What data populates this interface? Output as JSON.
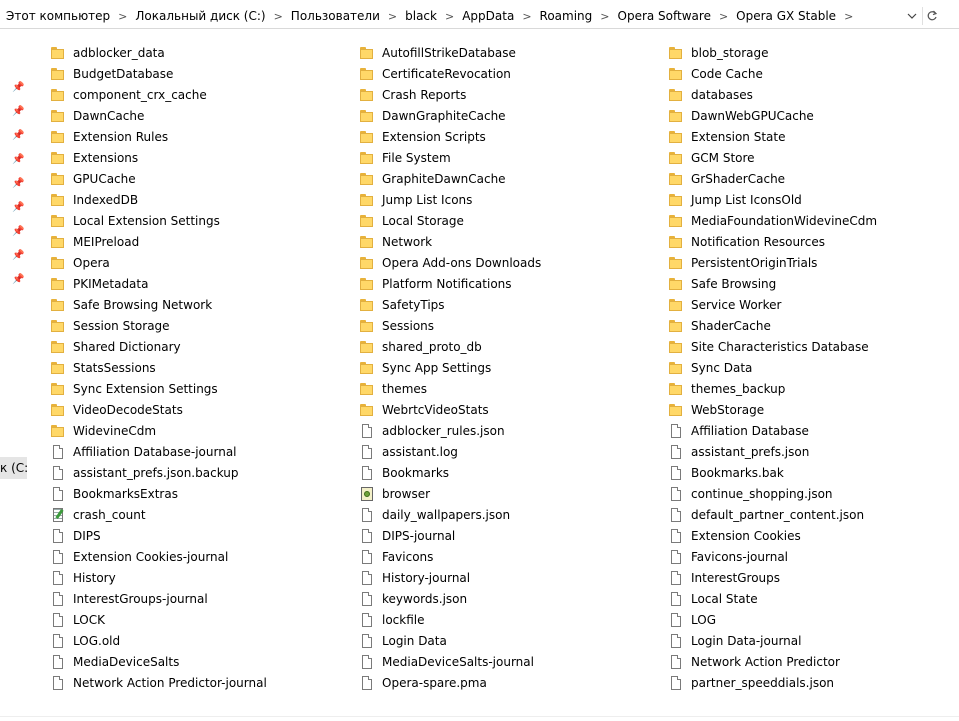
{
  "address": {
    "crumbs": [
      "Этот компьютер",
      "Локальный диск (C:)",
      "Пользователи",
      "black",
      "AppData",
      "Roaming",
      "Opera Software",
      "Opera GX Stable"
    ],
    "separator": ">"
  },
  "nav": {
    "drive_label": "к (C:)",
    "pin_glyph": "📌"
  },
  "columns": [
    [
      {
        "name": "adblocker_data",
        "type": "folder"
      },
      {
        "name": "BudgetDatabase",
        "type": "folder"
      },
      {
        "name": "component_crx_cache",
        "type": "folder"
      },
      {
        "name": "DawnCache",
        "type": "folder"
      },
      {
        "name": "Extension Rules",
        "type": "folder"
      },
      {
        "name": "Extensions",
        "type": "folder"
      },
      {
        "name": "GPUCache",
        "type": "folder"
      },
      {
        "name": "IndexedDB",
        "type": "folder"
      },
      {
        "name": "Local Extension Settings",
        "type": "folder"
      },
      {
        "name": "MEIPreload",
        "type": "folder"
      },
      {
        "name": "Opera",
        "type": "folder"
      },
      {
        "name": "PKIMetadata",
        "type": "folder"
      },
      {
        "name": "Safe Browsing Network",
        "type": "folder"
      },
      {
        "name": "Session Storage",
        "type": "folder"
      },
      {
        "name": "Shared Dictionary",
        "type": "folder"
      },
      {
        "name": "StatsSessions",
        "type": "folder"
      },
      {
        "name": "Sync Extension Settings",
        "type": "folder"
      },
      {
        "name": "VideoDecodeStats",
        "type": "folder"
      },
      {
        "name": "WidevineCdm",
        "type": "folder"
      },
      {
        "name": "Affiliation Database-journal",
        "type": "file"
      },
      {
        "name": "assistant_prefs.json.backup",
        "type": "file"
      },
      {
        "name": "BookmarksExtras",
        "type": "file"
      },
      {
        "name": "crash_count",
        "type": "text"
      },
      {
        "name": "DIPS",
        "type": "file"
      },
      {
        "name": "Extension Cookies-journal",
        "type": "file"
      },
      {
        "name": "History",
        "type": "file"
      },
      {
        "name": "InterestGroups-journal",
        "type": "file"
      },
      {
        "name": "LOCK",
        "type": "file"
      },
      {
        "name": "LOG.old",
        "type": "file"
      },
      {
        "name": "MediaDeviceSalts",
        "type": "file"
      },
      {
        "name": "Network Action Predictor-journal",
        "type": "file"
      }
    ],
    [
      {
        "name": "AutofillStrikeDatabase",
        "type": "folder"
      },
      {
        "name": "CertificateRevocation",
        "type": "folder"
      },
      {
        "name": "Crash Reports",
        "type": "folder"
      },
      {
        "name": "DawnGraphiteCache",
        "type": "folder"
      },
      {
        "name": "Extension Scripts",
        "type": "folder"
      },
      {
        "name": "File System",
        "type": "folder"
      },
      {
        "name": "GraphiteDawnCache",
        "type": "folder"
      },
      {
        "name": "Jump List Icons",
        "type": "folder"
      },
      {
        "name": "Local Storage",
        "type": "folder"
      },
      {
        "name": "Network",
        "type": "folder"
      },
      {
        "name": "Opera Add-ons Downloads",
        "type": "folder"
      },
      {
        "name": "Platform Notifications",
        "type": "folder"
      },
      {
        "name": "SafetyTips",
        "type": "folder"
      },
      {
        "name": "Sessions",
        "type": "folder"
      },
      {
        "name": "shared_proto_db",
        "type": "folder"
      },
      {
        "name": "Sync App Settings",
        "type": "folder"
      },
      {
        "name": "themes",
        "type": "folder"
      },
      {
        "name": "WebrtcVideoStats",
        "type": "folder"
      },
      {
        "name": "adblocker_rules.json",
        "type": "file"
      },
      {
        "name": "assistant.log",
        "type": "file"
      },
      {
        "name": "Bookmarks",
        "type": "file"
      },
      {
        "name": "browser",
        "type": "script"
      },
      {
        "name": "daily_wallpapers.json",
        "type": "file"
      },
      {
        "name": "DIPS-journal",
        "type": "file"
      },
      {
        "name": "Favicons",
        "type": "file"
      },
      {
        "name": "History-journal",
        "type": "file"
      },
      {
        "name": "keywords.json",
        "type": "file"
      },
      {
        "name": "lockfile",
        "type": "file"
      },
      {
        "name": "Login Data",
        "type": "file"
      },
      {
        "name": "MediaDeviceSalts-journal",
        "type": "file"
      },
      {
        "name": "Opera-spare.pma",
        "type": "file"
      }
    ],
    [
      {
        "name": "blob_storage",
        "type": "folder"
      },
      {
        "name": "Code Cache",
        "type": "folder"
      },
      {
        "name": "databases",
        "type": "folder"
      },
      {
        "name": "DawnWebGPUCache",
        "type": "folder"
      },
      {
        "name": "Extension State",
        "type": "folder"
      },
      {
        "name": "GCM Store",
        "type": "folder"
      },
      {
        "name": "GrShaderCache",
        "type": "folder"
      },
      {
        "name": "Jump List IconsOld",
        "type": "folder"
      },
      {
        "name": "MediaFoundationWidevineCdm",
        "type": "folder"
      },
      {
        "name": "Notification Resources",
        "type": "folder"
      },
      {
        "name": "PersistentOriginTrials",
        "type": "folder"
      },
      {
        "name": "Safe Browsing",
        "type": "folder"
      },
      {
        "name": "Service Worker",
        "type": "folder"
      },
      {
        "name": "ShaderCache",
        "type": "folder"
      },
      {
        "name": "Site Characteristics Database",
        "type": "folder"
      },
      {
        "name": "Sync Data",
        "type": "folder"
      },
      {
        "name": "themes_backup",
        "type": "folder"
      },
      {
        "name": "WebStorage",
        "type": "folder"
      },
      {
        "name": "Affiliation Database",
        "type": "file"
      },
      {
        "name": "assistant_prefs.json",
        "type": "file"
      },
      {
        "name": "Bookmarks.bak",
        "type": "file"
      },
      {
        "name": "continue_shopping.json",
        "type": "file"
      },
      {
        "name": "default_partner_content.json",
        "type": "file"
      },
      {
        "name": "Extension Cookies",
        "type": "file"
      },
      {
        "name": "Favicons-journal",
        "type": "file"
      },
      {
        "name": "InterestGroups",
        "type": "file"
      },
      {
        "name": "Local State",
        "type": "file"
      },
      {
        "name": "LOG",
        "type": "file"
      },
      {
        "name": "Login Data-journal",
        "type": "file"
      },
      {
        "name": "Network Action Predictor",
        "type": "file"
      },
      {
        "name": "partner_speeddials.json",
        "type": "file"
      }
    ]
  ]
}
